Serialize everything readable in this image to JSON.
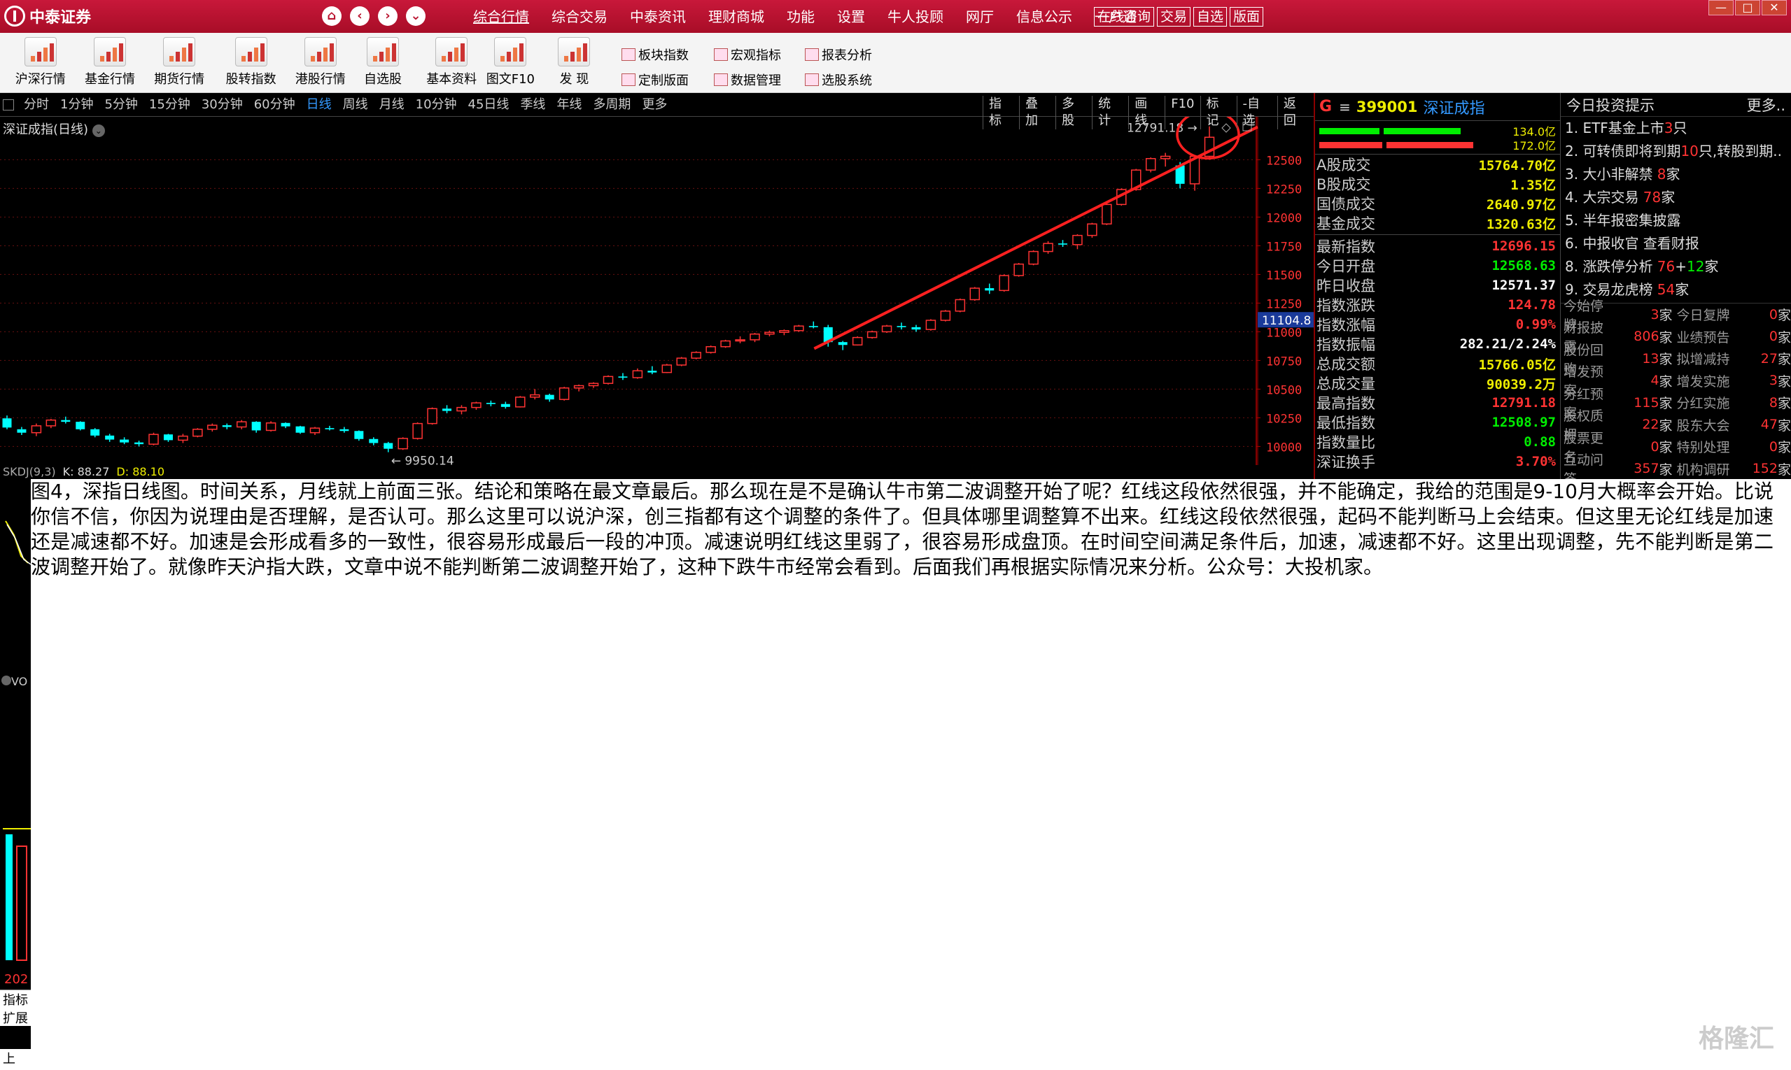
{
  "titlebar": {
    "app_name": "中泰证券",
    "menu": [
      "综合行情",
      "综合交易",
      "中泰资讯",
      "理财商城",
      "功能",
      "设置",
      "牛人投顾",
      "网厅",
      "信息公示",
      "一户通"
    ],
    "buttons": [
      "在线咨询",
      "交易",
      "自选",
      "版面"
    ]
  },
  "toolbar": {
    "tools": [
      "沪深行情",
      "基金行情",
      "期货行情",
      "股转指数",
      "港股行情",
      "自选股",
      "基本资料",
      "图文F10",
      "发 现"
    ],
    "small_tools": [
      "板块指数",
      "定制版面",
      "宏观指标",
      "数据管理",
      "报表分析",
      "选股系统"
    ]
  },
  "chart": {
    "periods": [
      "分时",
      "1分钟",
      "5分钟",
      "15分钟",
      "30分钟",
      "60分钟",
      "日线",
      "周线",
      "月线",
      "10分钟",
      "45日线",
      "季线",
      "年线",
      "多周期",
      "更多"
    ],
    "selected_period": "日线",
    "menu": [
      "指标",
      "叠加",
      "多股",
      "统计",
      "画线",
      "F10",
      "标记",
      "-自选",
      "返回"
    ],
    "title": "深证成指(日线)",
    "y_ticks": [
      "12500",
      "12250",
      "12000",
      "11750",
      "11500",
      "11250",
      "11000",
      "10750",
      "10500",
      "10250",
      "10000"
    ],
    "current_price_tag": "11104.8",
    "high_label": "12791.18",
    "low_label": "9950.14",
    "skdj": {
      "name": "SKDJ(9,3)",
      "k": "K: 88.27",
      "d": "D: 88.10"
    }
  },
  "chart_data": {
    "type": "candlestick",
    "title": "深证成指(日线)",
    "ylim": [
      9850,
      12850
    ],
    "y_ticks": [
      10000,
      10250,
      10500,
      10750,
      11000,
      11250,
      11500,
      11750,
      12000,
      12250,
      12500
    ],
    "ohlc": [
      [
        10245,
        10270,
        10150,
        10165
      ],
      [
        10150,
        10170,
        10100,
        10120
      ],
      [
        10120,
        10200,
        10090,
        10180
      ],
      [
        10180,
        10240,
        10160,
        10230
      ],
      [
        10230,
        10260,
        10200,
        10215
      ],
      [
        10215,
        10220,
        10140,
        10150
      ],
      [
        10150,
        10160,
        10080,
        10095
      ],
      [
        10095,
        10110,
        10040,
        10060
      ],
      [
        10060,
        10080,
        10020,
        10035
      ],
      [
        10035,
        10050,
        10000,
        10020
      ],
      [
        10020,
        10120,
        10010,
        10105
      ],
      [
        10105,
        10110,
        10040,
        10055
      ],
      [
        10055,
        10110,
        10030,
        10090
      ],
      [
        10090,
        10160,
        10080,
        10150
      ],
      [
        10150,
        10200,
        10130,
        10185
      ],
      [
        10185,
        10200,
        10150,
        10170
      ],
      [
        10170,
        10230,
        10150,
        10215
      ],
      [
        10215,
        10220,
        10120,
        10140
      ],
      [
        10140,
        10220,
        10130,
        10205
      ],
      [
        10205,
        10210,
        10160,
        10175
      ],
      [
        10175,
        10180,
        10110,
        10120
      ],
      [
        10120,
        10170,
        10100,
        10160
      ],
      [
        10160,
        10180,
        10140,
        10150
      ],
      [
        10150,
        10170,
        10120,
        10135
      ],
      [
        10135,
        10140,
        10050,
        10065
      ],
      [
        10065,
        10080,
        10010,
        10030
      ],
      [
        10030,
        10040,
        9950,
        9980
      ],
      [
        9980,
        10080,
        9970,
        10070
      ],
      [
        10070,
        10210,
        10060,
        10200
      ],
      [
        10200,
        10340,
        10190,
        10330
      ],
      [
        10330,
        10360,
        10290,
        10310
      ],
      [
        10310,
        10360,
        10280,
        10340
      ],
      [
        10340,
        10390,
        10320,
        10380
      ],
      [
        10380,
        10400,
        10350,
        10370
      ],
      [
        10370,
        10390,
        10330,
        10345
      ],
      [
        10345,
        10440,
        10340,
        10430
      ],
      [
        10430,
        10500,
        10410,
        10450
      ],
      [
        10450,
        10460,
        10390,
        10410
      ],
      [
        10410,
        10520,
        10400,
        10510
      ],
      [
        10510,
        10540,
        10480,
        10530
      ],
      [
        10530,
        10560,
        10510,
        10550
      ],
      [
        10550,
        10620,
        10540,
        10610
      ],
      [
        10610,
        10640,
        10580,
        10600
      ],
      [
        10600,
        10680,
        10590,
        10660
      ],
      [
        10660,
        10700,
        10630,
        10645
      ],
      [
        10645,
        10720,
        10640,
        10710
      ],
      [
        10710,
        10780,
        10700,
        10770
      ],
      [
        10770,
        10830,
        10760,
        10820
      ],
      [
        10820,
        10880,
        10810,
        10870
      ],
      [
        10870,
        10930,
        10860,
        10920
      ],
      [
        10920,
        10960,
        10900,
        10930
      ],
      [
        10930,
        10990,
        10910,
        10980
      ],
      [
        10980,
        11010,
        10960,
        10995
      ],
      [
        10995,
        11020,
        10970,
        11010
      ],
      [
        11010,
        11060,
        11000,
        11050
      ],
      [
        11050,
        11090,
        11030,
        11040
      ],
      [
        11040,
        11060,
        10870,
        10910
      ],
      [
        10910,
        10920,
        10840,
        10885
      ],
      [
        10885,
        10960,
        10880,
        10950
      ],
      [
        10950,
        11010,
        10940,
        11000
      ],
      [
        11000,
        11060,
        10990,
        11050
      ],
      [
        11050,
        11080,
        11020,
        11040
      ],
      [
        11040,
        11060,
        11000,
        11020
      ],
      [
        11020,
        11110,
        11010,
        11100
      ],
      [
        11100,
        11190,
        11090,
        11180
      ],
      [
        11180,
        11290,
        11170,
        11280
      ],
      [
        11280,
        11390,
        11270,
        11380
      ],
      [
        11380,
        11420,
        11330,
        11360
      ],
      [
        11360,
        11500,
        11350,
        11490
      ],
      [
        11490,
        11600,
        11480,
        11590
      ],
      [
        11590,
        11710,
        11580,
        11700
      ],
      [
        11700,
        11790,
        11680,
        11770
      ],
      [
        11770,
        11800,
        11740,
        11760
      ],
      [
        11760,
        11850,
        11720,
        11840
      ],
      [
        11840,
        11950,
        11820,
        11940
      ],
      [
        11940,
        12120,
        11930,
        12110
      ],
      [
        12110,
        12250,
        12100,
        12240
      ],
      [
        12240,
        12420,
        12230,
        12410
      ],
      [
        12410,
        12520,
        12390,
        12510
      ],
      [
        12510,
        12560,
        12440,
        12530
      ],
      [
        12450,
        12480,
        12250,
        12290
      ],
      [
        12290,
        12540,
        12230,
        12530
      ],
      [
        12530,
        12791,
        12500,
        12696
      ]
    ],
    "trendline": {
      "from_index": 54,
      "from_value": 10890,
      "to_index": 85,
      "to_value": 12700
    }
  },
  "index_panel": {
    "prefix": "G",
    "eq": "≡",
    "code": "399001",
    "name": "深证成指",
    "bar_values": [
      "134.0亿",
      "172.0亿"
    ],
    "rows_top": [
      {
        "label": "A股成交",
        "value": "15764.70亿",
        "cls": "y"
      },
      {
        "label": "B股成交",
        "value": "1.35亿",
        "cls": "y"
      },
      {
        "label": "国债成交",
        "value": "2640.97亿",
        "cls": "y"
      },
      {
        "label": "基金成交",
        "value": "1320.63亿",
        "cls": "y"
      }
    ],
    "rows": [
      {
        "label": "最新指数",
        "value": "12696.15",
        "cls": "r"
      },
      {
        "label": "今日开盘",
        "value": "12568.63",
        "cls": "g"
      },
      {
        "label": "昨日收盘",
        "value": "12571.37",
        "cls": "w"
      },
      {
        "label": "指数涨跌",
        "value": "124.78",
        "cls": "r"
      },
      {
        "label": "指数涨幅",
        "value": "0.99%",
        "cls": "r"
      },
      {
        "label": "指数振幅",
        "value": "282.21/2.24%",
        "cls": "w"
      },
      {
        "label": "总成交额",
        "value": "15766.05亿",
        "cls": "y"
      },
      {
        "label": "总成交量",
        "value": "90039.2万",
        "cls": "y"
      },
      {
        "label": "最高指数",
        "value": "12791.18",
        "cls": "r"
      },
      {
        "label": "最低指数",
        "value": "12508.97",
        "cls": "g"
      },
      {
        "label": "指数量比",
        "value": "0.88",
        "cls": "g"
      },
      {
        "label": "深证换手",
        "value": "3.70%",
        "cls": "r"
      }
    ]
  },
  "tips_panel": {
    "title": "今日投资提示",
    "more": "更多..",
    "items": [
      {
        "pre": "1. ETF基金上市",
        "num": "3",
        "post": "只"
      },
      {
        "pre": "2. 可转债即将到期",
        "num": "10",
        "post": "只,转股到期.."
      },
      {
        "pre": "3. 大小非解禁 ",
        "num": "8",
        "post": "家"
      },
      {
        "pre": "4. 大宗交易 ",
        "num": "78",
        "post": "家"
      },
      {
        "pre": "5. 半年报密集披露",
        "num": "",
        "post": ""
      },
      {
        "pre": "6. 中报收官  查看财报",
        "num": "",
        "post": ""
      },
      {
        "pre": "8. 涨跌停分析 ",
        "num": "76",
        "post": "+",
        "num2": "12",
        "post2": "家"
      },
      {
        "pre": "9. 交易龙虎榜 ",
        "num": "54",
        "post": "家"
      }
    ],
    "stats": [
      [
        "今始停牌",
        "3",
        "家",
        "今日复牌",
        "0",
        "家"
      ],
      [
        "财报披露",
        "806",
        "家",
        "业绩预告",
        "0",
        "家"
      ],
      [
        "股份回购",
        "13",
        "家",
        "拟增减持",
        "27",
        "家"
      ],
      [
        "增发预案",
        "4",
        "家",
        "增发实施",
        "3",
        "家"
      ],
      [
        "分红预案",
        "115",
        "家",
        "分红实施",
        "8",
        "家"
      ],
      [
        "股权质押",
        "22",
        "家",
        "股东大会",
        "47",
        "家"
      ],
      [
        "股票更名",
        "0",
        "家",
        "特别处理",
        "0",
        "家"
      ],
      [
        "互动问答",
        "357",
        "家",
        "机构调研",
        "152",
        "家"
      ]
    ]
  },
  "left_strip": {
    "label1": "VO",
    "label2": "202",
    "label3": "指标",
    "label4": "扩展",
    "label5": "上"
  },
  "article": {
    "text": "图4，深指日线图。时间关系，月线就上前面三张。结论和策略在最文章最后。那么现在是不是确认牛市第二波调整开始了呢？红线这段依然很强，并不能确定，我给的范围是9-10月大概率会开始。比说你信不信，你因为说理由是否理解，是否认可。那么这里可以说沪深，创三指都有这个调整的条件了。但具体哪里调整算不出来。红线这段依然很强，起码不能判断马上会结束。但这里无论红线是加速还是减速都不好。加速是会形成看多的一致性，很容易形成最后一段的冲顶。减速说明红线这里弱了，很容易形成盘顶。在时间空间满足条件后，加速，减速都不好。这里出现调整，先不能判断是第二波调整开始了。就像昨天沪指大跌，文章中说不能判断第二波调整开始了，这种下跌牛市经常会看到。后面我们再根据实际情况来分析。公众号：大投机家。"
  },
  "watermark": "格隆汇",
  "colors": {
    "up": "#ff3333",
    "down": "#00ffff",
    "trend": "#ff2020",
    "brand": "#b9122e"
  }
}
